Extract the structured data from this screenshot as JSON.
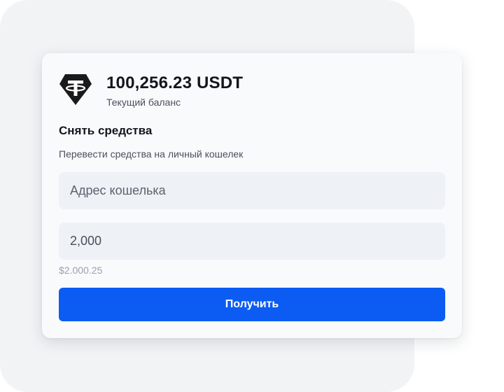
{
  "balance": {
    "amount": "100,256.23 USDT",
    "caption": "Текущий баланс",
    "token_icon": "tether-logo-icon"
  },
  "withdraw": {
    "title": "Снять средства",
    "subtitle": "Перевести средства на личный кошелек",
    "address_placeholder": "Адрес кошелька",
    "amount_value": "2,000",
    "fiat_equivalent": "$2.000.25",
    "submit_label": "Получить"
  },
  "colors": {
    "primary_button": "#0c5cf4",
    "card_background": "#f8fafc",
    "input_background": "#eef1f5",
    "backdrop": "#f2f3f5"
  }
}
